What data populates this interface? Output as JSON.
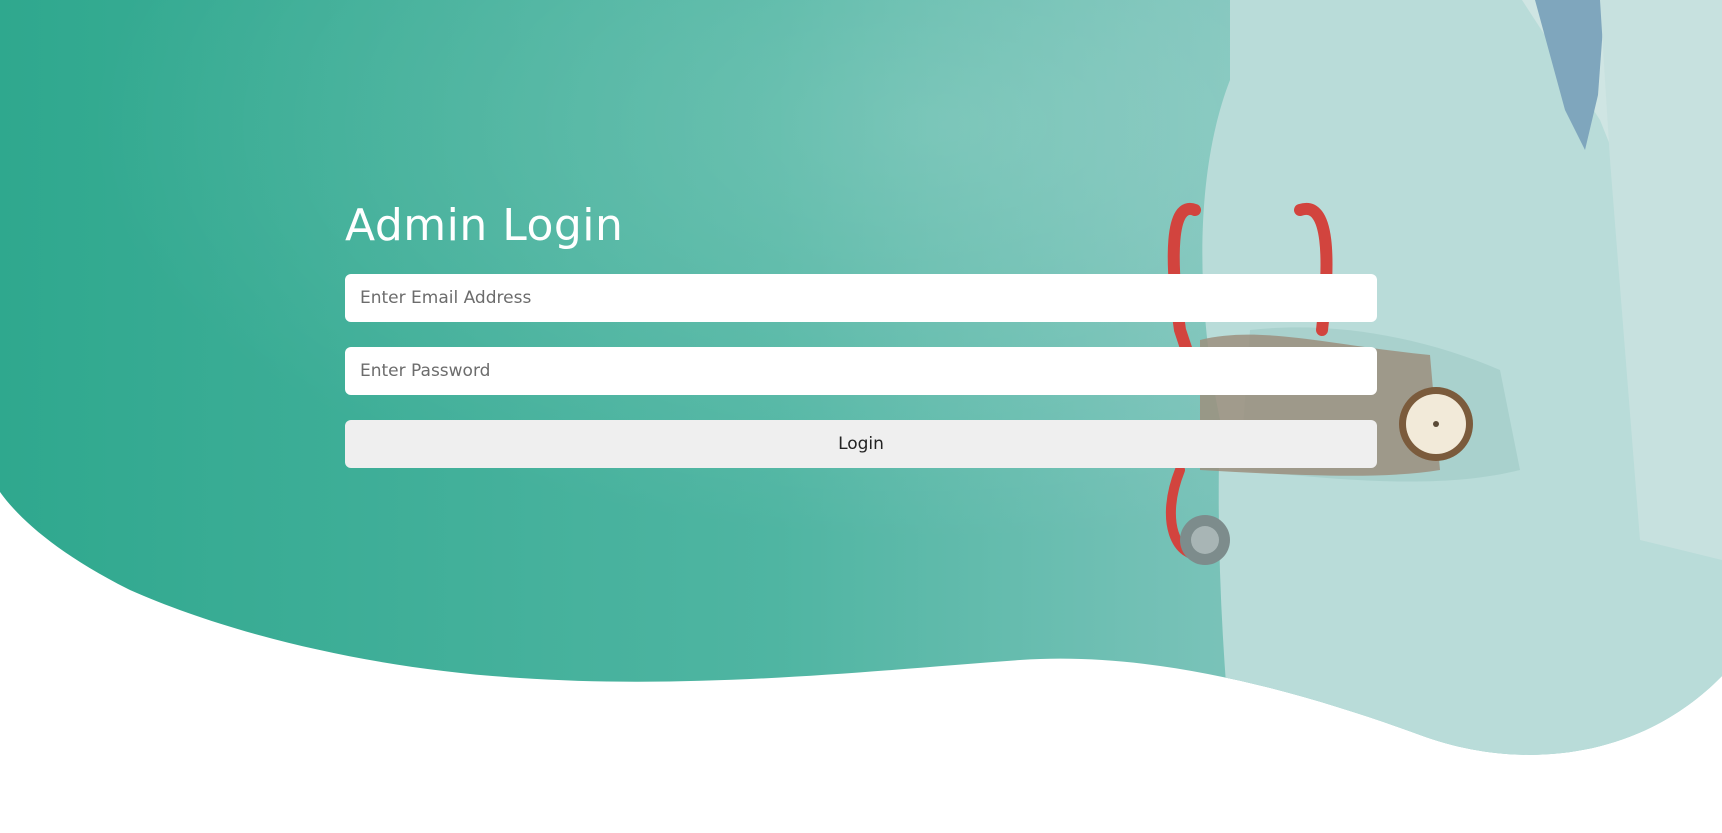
{
  "colors": {
    "teal_primary": "#2fa88e",
    "teal_light": "#76c3b8",
    "coat": "#b9dcd9",
    "stethoscope": "#d2443e",
    "input_bg": "#ffffff",
    "button_bg": "#efefef",
    "title_text": "#ffffff"
  },
  "hero": {
    "image_subject": "doctor-with-stethoscope-photo"
  },
  "login": {
    "title": "Admin Login",
    "email_placeholder": "Enter Email Address",
    "email_value": "",
    "password_placeholder": "Enter Password",
    "password_value": "",
    "submit_label": "Login"
  }
}
